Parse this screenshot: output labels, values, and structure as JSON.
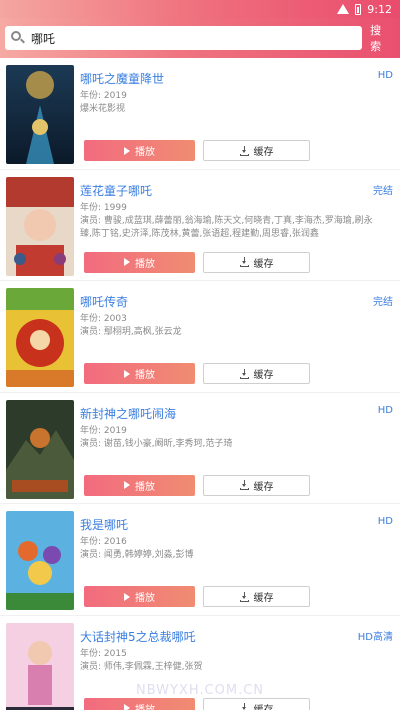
{
  "status": {
    "time": "9:12"
  },
  "search": {
    "value": "哪吒",
    "button": "搜索"
  },
  "actions": {
    "play": "播放",
    "download": "缓存"
  },
  "items": [
    {
      "title": "哪吒之魔童降世",
      "badge": "HD",
      "meta1": "年份: 2019",
      "meta2": "爆米花影视",
      "colors": [
        "#1c3a55",
        "#c9a24a"
      ]
    },
    {
      "title": "莲花童子哪吒",
      "badge": "完结",
      "meta1": "年份: 1999",
      "meta2": "演员: 曹骏,成蓝琪,薛蕾丽,翁海瑜,陈天文,何晓青,丁真,李海杰,罗海瑜,刷永臻,陈丁铭,史济泽,陈茂林,黄蕾,张语超,程建勤,周思睿,张润鑫",
      "colors": [
        "#b33a2e",
        "#e8c7b0"
      ]
    },
    {
      "title": "哪吒传奇",
      "badge": "完结",
      "meta1": "年份: 2003",
      "meta2": "演员: 鄢栩玥,高枫,张云龙",
      "colors": [
        "#e8c234",
        "#c8321d"
      ]
    },
    {
      "title": "新封神之哪吒闹海",
      "badge": "HD",
      "meta1": "年份: 2019",
      "meta2": "演员: 谢苗,钱小豪,阚昕,李秀珂,范子琦",
      "colors": [
        "#2d3b2a",
        "#c8732e"
      ]
    },
    {
      "title": "我是哪吒",
      "badge": "HD",
      "meta1": "年份: 2016",
      "meta2": "演员: 闻勇,韩婷婷,刘淼,彭博",
      "colors": [
        "#5bb2e0",
        "#e36a2c"
      ]
    },
    {
      "title": "大话封神5之总裁哪吒",
      "badge": "HD高清",
      "meta1": "年份: 2015",
      "meta2": "演员: 师伟,李佩霖,王梓健,张贺",
      "colors": [
        "#d87fb0",
        "#2a2a3a"
      ]
    }
  ],
  "watermark": "NBWYXH.COM.CN"
}
